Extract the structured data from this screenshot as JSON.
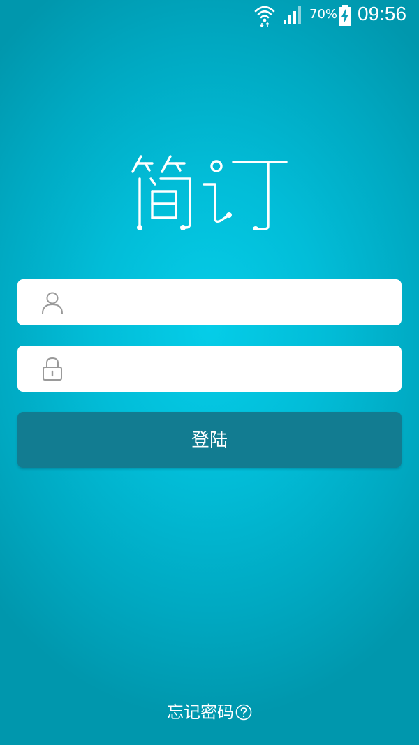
{
  "status_bar": {
    "battery_percent": "70%",
    "time": "09:56",
    "icons": [
      "wifi-icon",
      "signal-icon",
      "battery-charging-icon"
    ]
  },
  "logo": {
    "text": "简订"
  },
  "login_form": {
    "username_icon": "user-icon",
    "username_value": "",
    "username_placeholder": "",
    "password_icon": "lock-icon",
    "password_value": "",
    "password_placeholder": "",
    "login_label": "登陆"
  },
  "footer": {
    "forgot_password_label": "忘记密码",
    "help_icon": "question-circle-icon"
  },
  "colors": {
    "background_center": "#05cde8",
    "background_edge": "#0097ad",
    "button": "#127c91",
    "field": "#ffffff",
    "icon_gray": "#9a9a9a"
  }
}
